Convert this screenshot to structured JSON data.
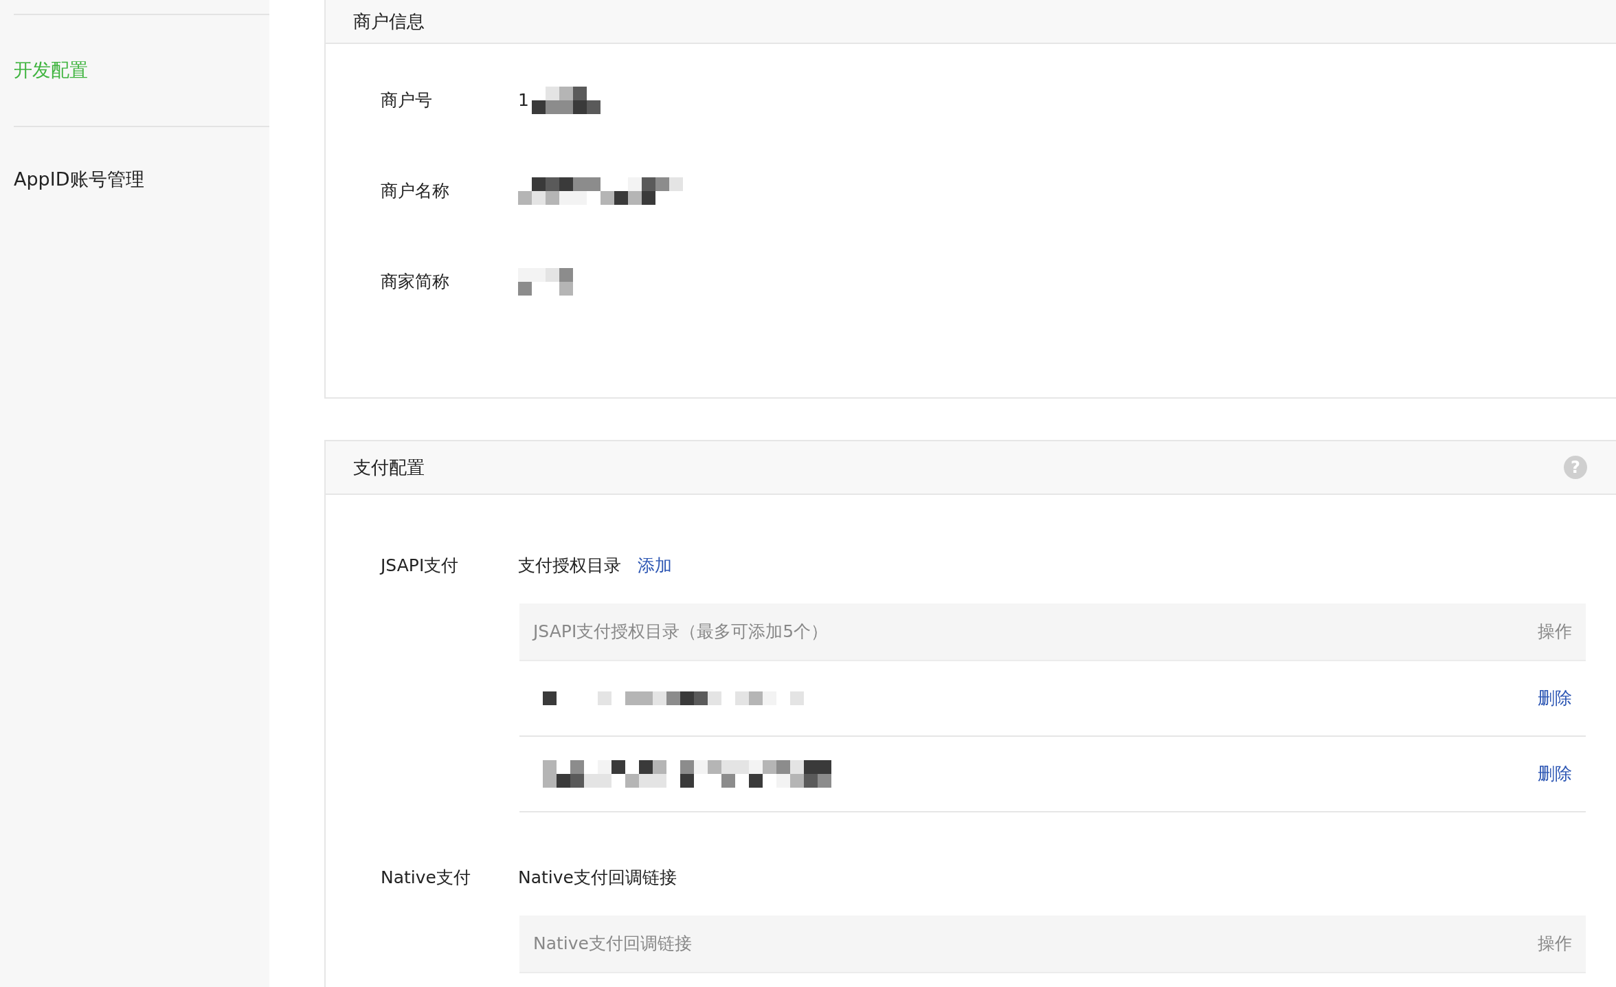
{
  "sidebar": {
    "items": [
      {
        "label": "开发配置",
        "selected": true
      },
      {
        "label": "AppID账号管理",
        "selected": false
      }
    ]
  },
  "merchant_info": {
    "title": "商户信息",
    "fields": [
      {
        "label": "商户号",
        "value": "1",
        "masked": true
      },
      {
        "label": "商户名称",
        "masked": true
      },
      {
        "label": "商家简称",
        "masked": true
      }
    ]
  },
  "payment_config": {
    "title": "支付配置",
    "help": "?",
    "sections": [
      {
        "label": "JSAPI支付",
        "subtitle": "支付授权目录",
        "action": "添加",
        "table": {
          "columns": [
            "JSAPI支付授权目录（最多可添加5个）",
            "操作"
          ],
          "rows": [
            {
              "masked": true,
              "action": "删除"
            },
            {
              "masked": true,
              "action": "删除"
            }
          ]
        }
      },
      {
        "label": "Native支付",
        "subtitle": "Native支付回调链接",
        "table": {
          "columns": [
            "Native支付回调链接",
            "操作"
          ]
        }
      }
    ]
  }
}
